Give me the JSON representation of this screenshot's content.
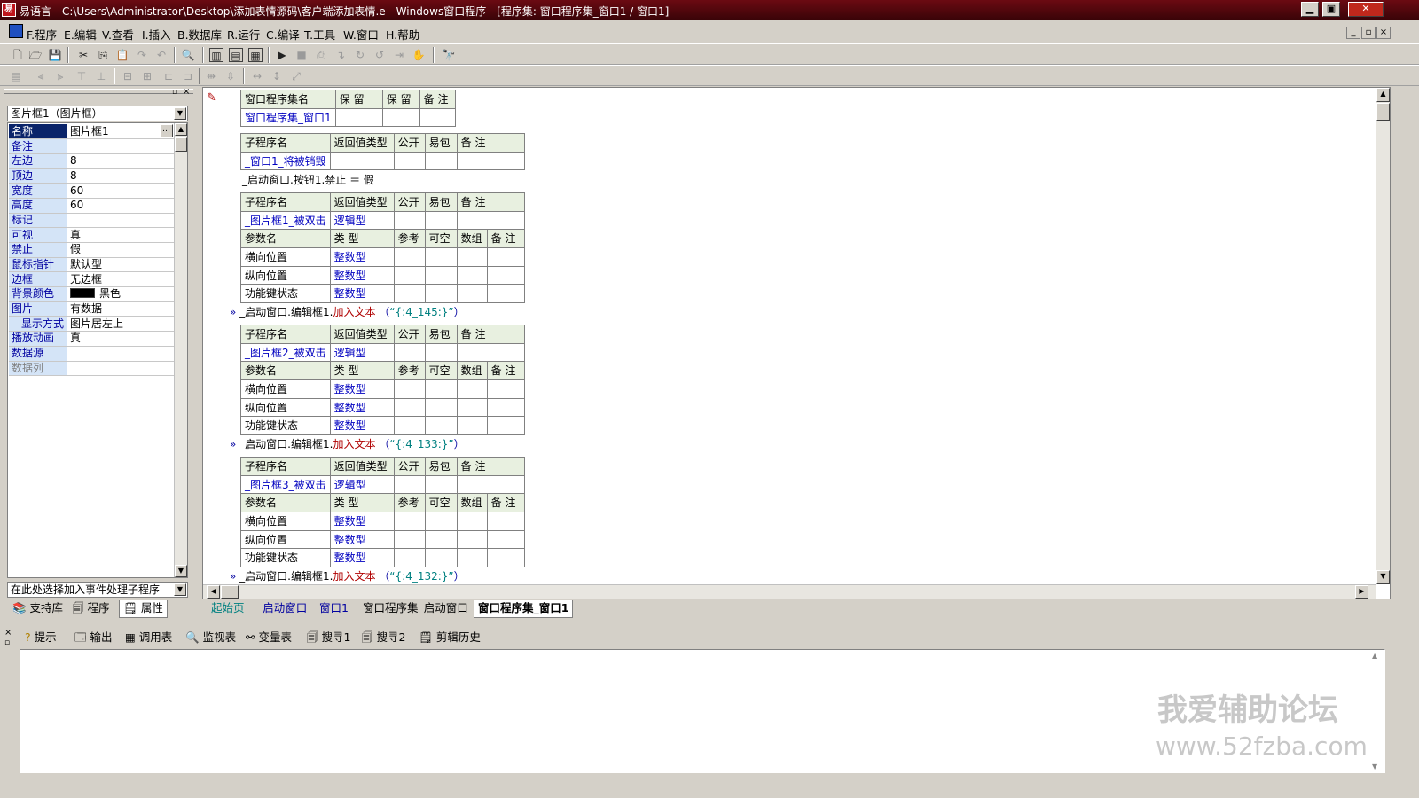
{
  "window": {
    "title": "易语言 - C:\\Users\\Administrator\\Desktop\\添加表情源码\\客户端添加表情.e - Windows窗口程序 - [程序集: 窗口程序集_窗口1 / 窗口1]",
    "min": "▁",
    "max": "▣",
    "close": "✕"
  },
  "menu": [
    {
      "label": "F.程序"
    },
    {
      "label": "E.编辑"
    },
    {
      "label": "V.查看"
    },
    {
      "label": "I.插入"
    },
    {
      "label": "B.数据库"
    },
    {
      "label": "R.运行"
    },
    {
      "label": "C.编译"
    },
    {
      "label": "T.工具"
    },
    {
      "label": "W.窗口"
    },
    {
      "label": "H.帮助"
    }
  ],
  "properties": {
    "object_combo": "图片框1（图片框）",
    "rows": [
      {
        "k": "名称",
        "v": "图片框1"
      },
      {
        "k": "备注",
        "v": ""
      },
      {
        "k": "左边",
        "v": "8"
      },
      {
        "k": "顶边",
        "v": "8"
      },
      {
        "k": "宽度",
        "v": "60"
      },
      {
        "k": "高度",
        "v": "60"
      },
      {
        "k": "标记",
        "v": ""
      },
      {
        "k": "可视",
        "v": "真"
      },
      {
        "k": "禁止",
        "v": "假"
      },
      {
        "k": "鼠标指针",
        "v": "默认型"
      },
      {
        "k": "边框",
        "v": "无边框"
      },
      {
        "k": "背景颜色",
        "v": "黑色"
      },
      {
        "k": "图片",
        "v": "有数据"
      },
      {
        "k": "显示方式",
        "v": "图片居左上"
      },
      {
        "k": "播放动画",
        "v": "真"
      },
      {
        "k": "数据源",
        "v": ""
      },
      {
        "k": "数据列",
        "v": ""
      }
    ],
    "event_combo": "在此处选择加入事件处理子程序",
    "ellipsis": "…",
    "bgcolor": "#000000"
  },
  "left_tabs": [
    {
      "label": "支持库"
    },
    {
      "label": "程序"
    },
    {
      "label": "属性"
    }
  ],
  "editor": {
    "assembly_header": [
      "窗口程序集名",
      "保 留",
      "保 留",
      "备 注"
    ],
    "assembly_name": "窗口程序集_窗口1",
    "sub_header": [
      "子程序名",
      "返回值类型",
      "公开",
      "易包",
      "备 注"
    ],
    "param_header": [
      "参数名",
      "类 型",
      "参考",
      "可空",
      "数组",
      "备 注"
    ],
    "sub1_name": "_窗口1_将被销毁",
    "code1": "_启动窗口.按钮1.禁止 ＝ 假",
    "sub2_name": "_图片框1_被双击",
    "sub2_ret": "逻辑型",
    "sub3_name": "_图片框2_被双击",
    "sub3_ret": "逻辑型",
    "sub4_name": "_图片框3_被双击",
    "sub4_ret": "逻辑型",
    "params": [
      {
        "n": "横向位置",
        "t": "整数型"
      },
      {
        "n": "纵向位置",
        "t": "整数型"
      },
      {
        "n": "功能键状态",
        "t": "整数型"
      }
    ],
    "code_prefix": "_启动窗口.编辑框1.",
    "code_method": "加入文本",
    "code2_arg": "“{:4_145:}”",
    "code3_arg": "“{:4_133:}”",
    "code4_arg": "“{:4_132:}”",
    "lp": "（",
    "rp": "）",
    "marker": "»"
  },
  "doc_tabs": [
    {
      "label": "起始页"
    },
    {
      "label": "_启动窗口"
    },
    {
      "label": "窗口1"
    },
    {
      "label": "窗口程序集_启动窗口"
    },
    {
      "label": "窗口程序集_窗口1"
    }
  ],
  "bottom_tabs": [
    {
      "label": "提示"
    },
    {
      "label": "输出"
    },
    {
      "label": "调用表"
    },
    {
      "label": "监视表"
    },
    {
      "label": "变量表"
    },
    {
      "label": "搜寻1"
    },
    {
      "label": "搜寻2"
    },
    {
      "label": "剪辑历史"
    }
  ],
  "watermark": {
    "line1": "我爱辅助论坛",
    "line2": "www.52fzba.com"
  }
}
